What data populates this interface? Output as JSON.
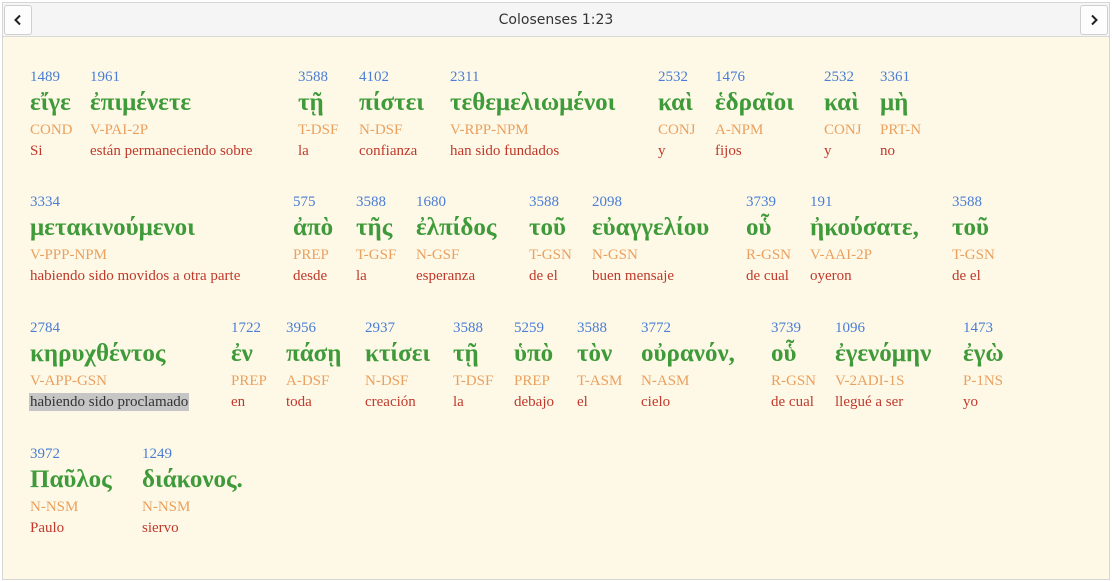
{
  "header": {
    "title": "Colosenses 1:23",
    "prev_icon": "chevron-left-icon",
    "next_icon": "chevron-right-icon"
  },
  "colors": {
    "strong": "#4a7dd4",
    "greek": "#3f9a3a",
    "morph": "#eaa05e",
    "gloss": "#c0392b",
    "background": "#fef9e7"
  },
  "rows": [
    {
      "words": [
        {
          "strong": "1489",
          "greek": "εἴγε",
          "morph": "COND",
          "gloss": "Si"
        },
        {
          "strong": "1961",
          "greek": "ἐπιμένετε",
          "morph": "V-PAI-2P",
          "gloss": "están permaneciendo sobre"
        },
        {
          "strong": "3588",
          "greek": "τῇ",
          "morph": "T-DSF",
          "gloss": "la"
        },
        {
          "strong": "4102",
          "greek": "πίστει",
          "morph": "N-DSF",
          "gloss": "confianza"
        },
        {
          "strong": "2311",
          "greek": "τεθεμελιωμένοι",
          "morph": "V-RPP-NPM",
          "gloss": "han sido fundados"
        },
        {
          "strong": "2532",
          "greek": "καὶ",
          "morph": "CONJ",
          "gloss": "y"
        },
        {
          "strong": "1476",
          "greek": "ἑδραῖοι",
          "morph": "A-NPM",
          "gloss": "fijos"
        },
        {
          "strong": "2532",
          "greek": "καὶ",
          "morph": "CONJ",
          "gloss": "y"
        },
        {
          "strong": "3361",
          "greek": "μὴ",
          "morph": "PRT-N",
          "gloss": "no"
        }
      ]
    },
    {
      "words": [
        {
          "strong": "3334",
          "greek": "μετακινούμενοι",
          "morph": "V-PPP-NPM",
          "gloss": "habiendo sido movidos a otra parte"
        },
        {
          "strong": "575",
          "greek": "ἀπὸ",
          "morph": "PREP",
          "gloss": "desde"
        },
        {
          "strong": "3588",
          "greek": "τῆς",
          "morph": "T-GSF",
          "gloss": "la"
        },
        {
          "strong": "1680",
          "greek": "ἐλπίδος",
          "morph": "N-GSF",
          "gloss": "esperanza"
        },
        {
          "strong": "3588",
          "greek": "τοῦ",
          "morph": "T-GSN",
          "gloss": "de el"
        },
        {
          "strong": "2098",
          "greek": "εὐαγγελίου",
          "morph": "N-GSN",
          "gloss": "buen mensaje"
        },
        {
          "strong": "3739",
          "greek": "οὗ",
          "morph": "R-GSN",
          "gloss": "de cual"
        },
        {
          "strong": "191",
          "greek": "ἠκούσατε,",
          "morph": "V-AAI-2P",
          "gloss": "oyeron"
        },
        {
          "strong": "3588",
          "greek": "τοῦ",
          "morph": "T-GSN",
          "gloss": "de el"
        }
      ]
    },
    {
      "words": [
        {
          "strong": "2784",
          "greek": "κηρυχθέντος",
          "morph": "V-APP-GSN",
          "gloss": "habiendo sido proclamado"
        },
        {
          "strong": "1722",
          "greek": "ἐν",
          "morph": "PREP",
          "gloss": "en"
        },
        {
          "strong": "3956",
          "greek": "πάσῃ",
          "morph": "A-DSF",
          "gloss": "toda"
        },
        {
          "strong": "2937",
          "greek": "κτίσει",
          "morph": "N-DSF",
          "gloss": "creación"
        },
        {
          "strong": "3588",
          "greek": "τῇ",
          "morph": "T-DSF",
          "gloss": "la"
        },
        {
          "strong": "5259",
          "greek": "ὑπὸ",
          "morph": "PREP",
          "gloss": "debajo"
        },
        {
          "strong": "3588",
          "greek": "τὸν",
          "morph": "T-ASM",
          "gloss": "el"
        },
        {
          "strong": "3772",
          "greek": "οὐρανόν,",
          "morph": "N-ASM",
          "gloss": "cielo"
        },
        {
          "strong": "3739",
          "greek": "οὗ",
          "morph": "R-GSN",
          "gloss": "de cual"
        },
        {
          "strong": "1096",
          "greek": "ἐγενόμην",
          "morph": "V-2ADI-1S",
          "gloss": "llegué a ser"
        },
        {
          "strong": "1473",
          "greek": "ἐγὼ",
          "morph": "P-1NS",
          "gloss": "yo"
        }
      ]
    },
    {
      "words": [
        {
          "strong": "3972",
          "greek": "Παῦλος",
          "morph": "N-NSM",
          "gloss": "Paulo"
        },
        {
          "strong": "1249",
          "greek": "διάκονος.",
          "morph": "N-NSM",
          "gloss": "siervo"
        }
      ]
    }
  ],
  "selected_gloss": "habiendo sido proclamado"
}
